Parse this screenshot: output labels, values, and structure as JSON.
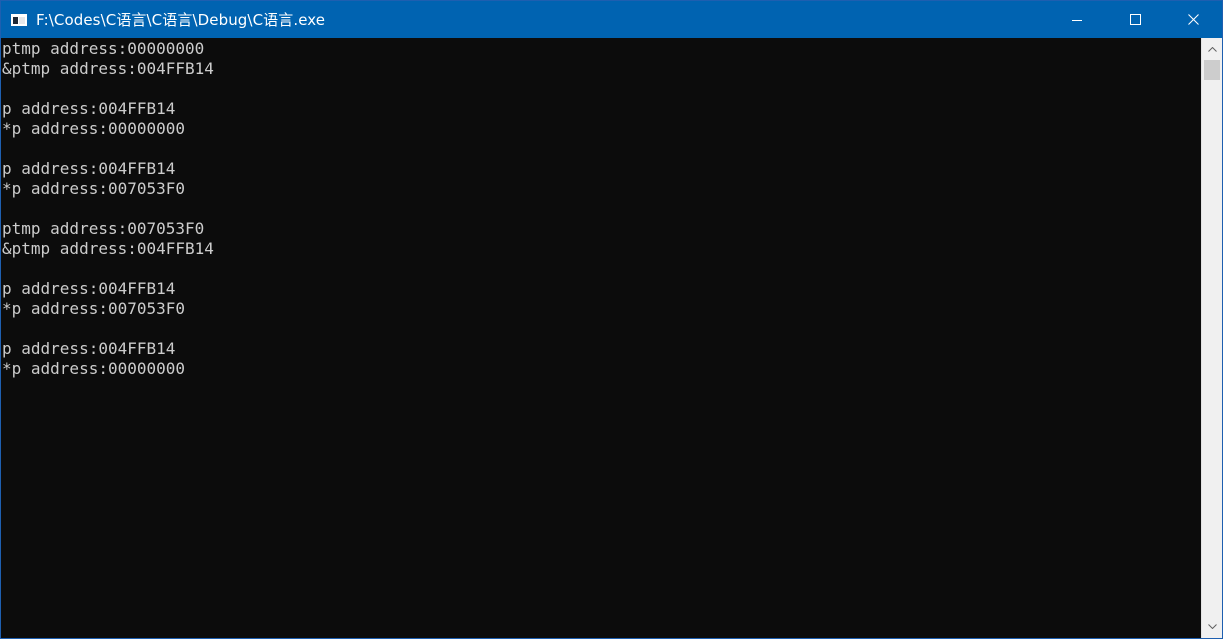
{
  "window": {
    "title": "F:\\Codes\\C语言\\C语言\\Debug\\C语言.exe",
    "accent_color": "#0063b1",
    "console_background": "#0c0c0c",
    "console_foreground": "#cccccc"
  },
  "title_bar_icons": {
    "app": "console-app-icon",
    "minimize": "minimize-icon",
    "maximize": "maximize-icon",
    "close": "close-icon"
  },
  "console": {
    "lines": [
      "ptmp address:00000000",
      "&ptmp address:004FFB14",
      "",
      "p address:004FFB14",
      "*p address:00000000",
      "",
      "p address:004FFB14",
      "*p address:007053F0",
      "",
      "ptmp address:007053F0",
      "&ptmp address:004FFB14",
      "",
      "p address:004FFB14",
      "*p address:007053F0",
      "",
      "p address:004FFB14",
      "*p address:00000000"
    ]
  }
}
